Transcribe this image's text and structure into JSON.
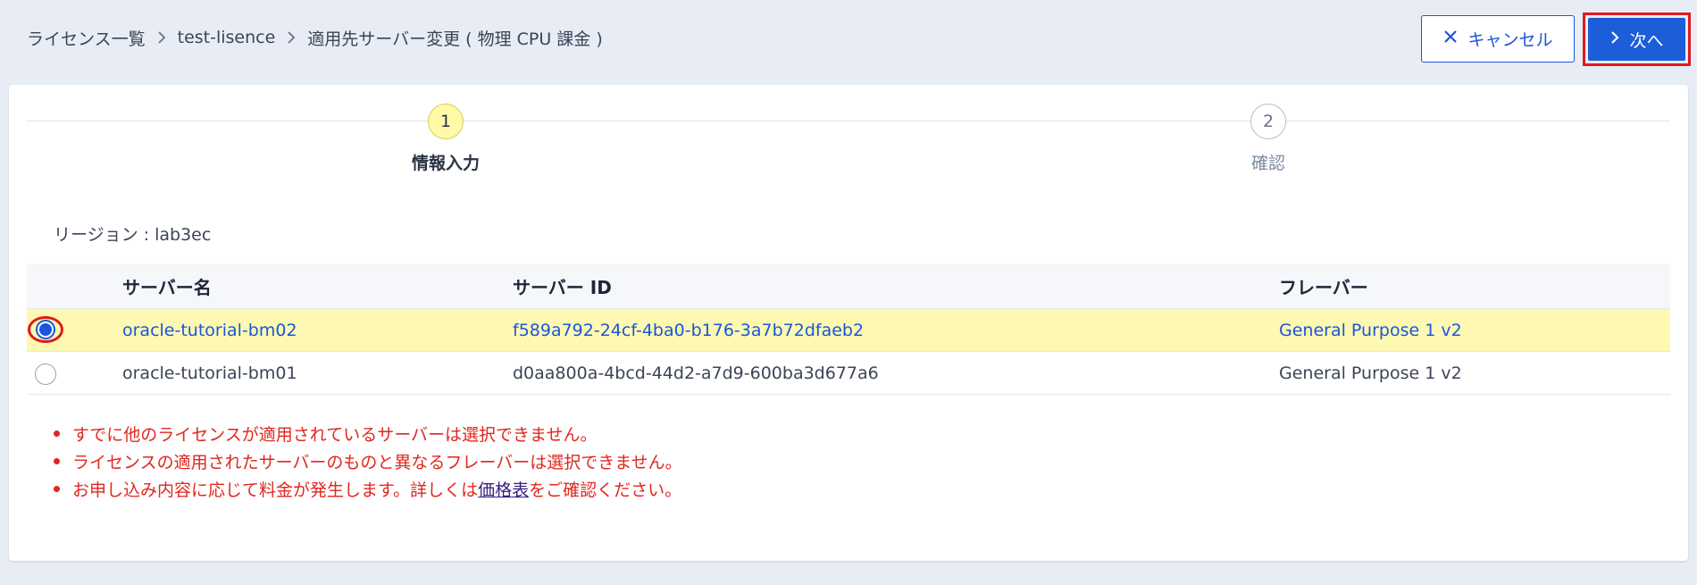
{
  "breadcrumb": {
    "items": [
      "ライセンス一覧",
      "test-lisence",
      "適用先サーバー変更 ( 物理 CPU 課金 )"
    ]
  },
  "actions": {
    "cancel_label": "キャンセル",
    "next_label": "次へ"
  },
  "stepper": {
    "steps": [
      {
        "number": "1",
        "label": "情報入力",
        "state": "active"
      },
      {
        "number": "2",
        "label": "確認",
        "state": "inactive"
      }
    ]
  },
  "region": "リージョン : lab3ec",
  "table": {
    "columns": [
      "サーバー名",
      "サーバー ID",
      "フレーバー"
    ],
    "rows": [
      {
        "name": "oracle-tutorial-bm02",
        "id": "f589a792-24cf-4ba0-b176-3a7b72dfaeb2",
        "flavor": "General Purpose 1 v2",
        "selected": true
      },
      {
        "name": "oracle-tutorial-bm01",
        "id": "d0aa800a-4bcd-44d2-a7d9-600ba3d677a6",
        "flavor": "General Purpose 1 v2",
        "selected": false
      }
    ]
  },
  "notes": {
    "note1": "すでに他のライセンスが適用されているサーバーは選択できません。",
    "note2": "ライセンスの適用されたサーバーのものと異なるフレーバーは選択できません。",
    "note3_before": "お申し込み内容に応じて料金が発生します。詳しくは",
    "note3_link": "価格表",
    "note3_after": "をご確認ください。"
  },
  "colors": {
    "primary": "#1c5ed9",
    "highlight_row": "#fdf9b2",
    "warning_text": "#e0271e",
    "annotation_red": "#e1191e",
    "page_bg": "#e8ecf4"
  },
  "icons": [
    "chevron-right-icon",
    "close-icon"
  ]
}
